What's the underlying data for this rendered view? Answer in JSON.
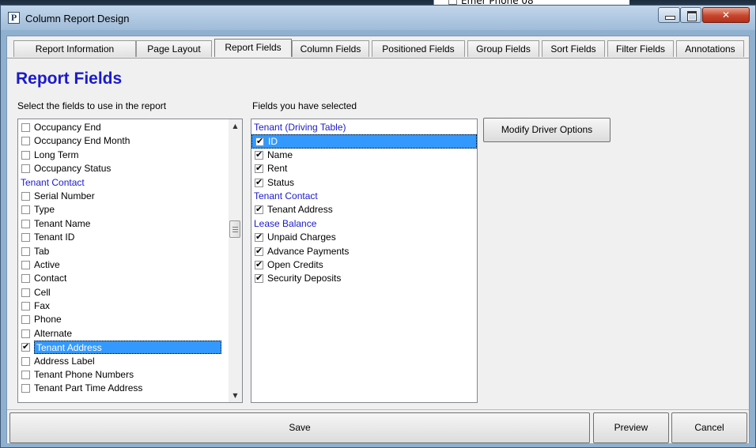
{
  "background_app": {
    "item_label": "Emer Phone 08"
  },
  "window": {
    "title": "Column Report Design",
    "app_icon_letter": "P"
  },
  "tabs": [
    {
      "label": "Report Information",
      "active": false
    },
    {
      "label": "Page Layout",
      "active": false
    },
    {
      "label": "Report Fields",
      "active": true
    },
    {
      "label": "Column Fields",
      "active": false
    },
    {
      "label": "Positioned Fields",
      "active": false
    },
    {
      "label": "Group Fields",
      "active": false
    },
    {
      "label": "Sort Fields",
      "active": false
    },
    {
      "label": "Filter Fields",
      "active": false
    },
    {
      "label": "Annotations",
      "active": false
    }
  ],
  "heading": "Report Fields",
  "left_panel": {
    "label": "Select the fields to use in the report",
    "items": [
      {
        "text": "Occupancy End",
        "type": "field",
        "checked": false
      },
      {
        "text": "Occupancy End Month",
        "type": "field",
        "checked": false
      },
      {
        "text": "Long Term",
        "type": "field",
        "checked": false
      },
      {
        "text": "Occupancy Status",
        "type": "field",
        "checked": false
      },
      {
        "text": "Tenant Contact",
        "type": "group"
      },
      {
        "text": "Serial Number",
        "type": "field",
        "checked": false
      },
      {
        "text": "Type",
        "type": "field",
        "checked": false
      },
      {
        "text": "Tenant Name",
        "type": "field",
        "checked": false
      },
      {
        "text": "Tenant ID",
        "type": "field",
        "checked": false
      },
      {
        "text": "Tab",
        "type": "field",
        "checked": false
      },
      {
        "text": "Active",
        "type": "field",
        "checked": false
      },
      {
        "text": "Contact",
        "type": "field",
        "checked": false
      },
      {
        "text": "Cell",
        "type": "field",
        "checked": false
      },
      {
        "text": "Fax",
        "type": "field",
        "checked": false
      },
      {
        "text": "Phone",
        "type": "field",
        "checked": false
      },
      {
        "text": "Alternate",
        "type": "field",
        "checked": false
      },
      {
        "text": "Tenant Address",
        "type": "field",
        "checked": true,
        "selected": true
      },
      {
        "text": "Address Label",
        "type": "field",
        "checked": false
      },
      {
        "text": "Tenant Phone Numbers",
        "type": "field",
        "checked": false
      },
      {
        "text": "Tenant Part Time Address",
        "type": "field",
        "checked": false
      }
    ]
  },
  "right_panel": {
    "label": "Fields you have selected",
    "items": [
      {
        "text": "Tenant (Driving Table)",
        "type": "group"
      },
      {
        "text": "ID",
        "type": "field",
        "checked": true,
        "selected": true
      },
      {
        "text": "Name",
        "type": "field",
        "checked": true
      },
      {
        "text": "Rent",
        "type": "field",
        "checked": true
      },
      {
        "text": "Status",
        "type": "field",
        "checked": true
      },
      {
        "text": "Tenant Contact",
        "type": "group"
      },
      {
        "text": "Tenant Address",
        "type": "field",
        "checked": true
      },
      {
        "text": "Lease Balance",
        "type": "group"
      },
      {
        "text": "Unpaid Charges",
        "type": "field",
        "checked": true
      },
      {
        "text": "Advance Payments",
        "type": "field",
        "checked": true
      },
      {
        "text": "Open Credits",
        "type": "field",
        "checked": true
      },
      {
        "text": "Security Deposits",
        "type": "field",
        "checked": true
      }
    ]
  },
  "buttons": {
    "modify_driver": "Modify Driver Options",
    "save": "Save",
    "preview": "Preview",
    "cancel": "Cancel"
  },
  "colors": {
    "group_text": "#1a1acc",
    "selection": "#3399ff",
    "title_bar": "#9fbcd9",
    "close_button": "#c7452c"
  }
}
